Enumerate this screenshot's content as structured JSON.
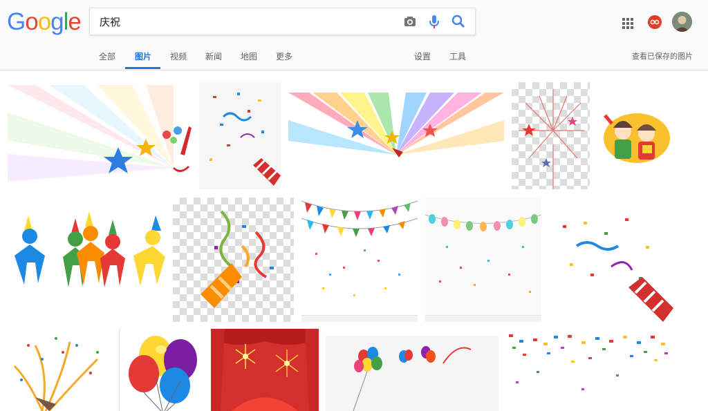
{
  "logo": {
    "letters": [
      "G",
      "o",
      "o",
      "g",
      "l",
      "e"
    ],
    "colors": [
      "#4285f4",
      "#ea4335",
      "#fbbc05",
      "#4285f4",
      "#34a853",
      "#ea4335"
    ]
  },
  "search": {
    "query": "庆祝"
  },
  "icons": {
    "camera": "camera-icon",
    "mic": "microphone-icon",
    "search": "search-icon",
    "apps": "apps-grid-icon"
  },
  "tabs": {
    "all": "全部",
    "images": "图片",
    "videos": "视频",
    "news": "新闻",
    "maps": "地图",
    "more": "更多",
    "settings": "设置",
    "tools": "工具"
  },
  "saved_images_link": "查看已保存的图片",
  "colors": {
    "accent": "#1a73e8",
    "tab_text": "#5f6368"
  }
}
